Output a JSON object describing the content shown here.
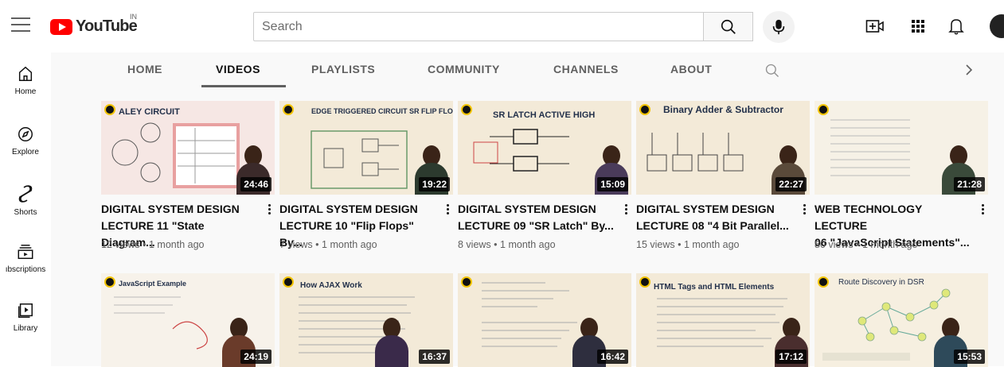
{
  "header": {
    "logo_text": "YouTube",
    "country": "IN",
    "search_placeholder": "Search",
    "icons": [
      "menu-icon",
      "search-icon",
      "mic-icon",
      "create-video-icon",
      "apps-grid-icon",
      "notifications-bell-icon",
      "avatar"
    ]
  },
  "sidebar": {
    "items": [
      {
        "label": "Home",
        "icon": "home-icon"
      },
      {
        "label": "Explore",
        "icon": "compass-icon"
      },
      {
        "label": "Shorts",
        "icon": "shorts-icon"
      },
      {
        "label": "ıbscriptions",
        "icon": "subscriptions-icon"
      },
      {
        "label": "Library",
        "icon": "library-icon"
      }
    ]
  },
  "tabs": {
    "items": [
      "HOME",
      "VIDEOS",
      "PLAYLISTS",
      "COMMUNITY",
      "CHANNELS",
      "ABOUT"
    ],
    "active": "VIDEOS"
  },
  "videos": [
    {
      "title_line1": "DIGITAL SYSTEM DESIGN",
      "title_line2": "LECTURE 11 \"State Diagram...",
      "views": "12 views",
      "age": "1 month ago",
      "duration": "24:46",
      "thumb_text": "ALEY CIRCUIT"
    },
    {
      "title_line1": "DIGITAL SYSTEM DESIGN",
      "title_line2": "LECTURE 10 \"Flip Flops\" By...",
      "views": "7 views",
      "age": "1 month ago",
      "duration": "19:22",
      "thumb_text": "EDGE TRIGGERED CIRCUIT SR FLIP FLOP"
    },
    {
      "title_line1": "DIGITAL SYSTEM DESIGN",
      "title_line2": "LECTURE 09 \"SR Latch\" By...",
      "views": "8 views",
      "age": "1 month ago",
      "duration": "15:09",
      "thumb_text": "SR LATCH ACTIVE HIGH"
    },
    {
      "title_line1": "DIGITAL SYSTEM DESIGN",
      "title_line2": "LECTURE 08 \"4 Bit Parallel...",
      "views": "15 views",
      "age": "1 month ago",
      "duration": "22:27",
      "thumb_text": "Binary Adder & Subtractor"
    },
    {
      "title_line1": "WEB TECHNOLOGY LECTURE",
      "title_line2": "06 \"JavaScript Statements\"...",
      "views": "80 views",
      "age": "1 month ago",
      "duration": "21:28",
      "thumb_text": ""
    },
    {
      "duration": "24:19",
      "thumb_text": "JavaScript Example"
    },
    {
      "duration": "16:37",
      "thumb_text": "How AJAX Work"
    },
    {
      "duration": "16:42",
      "thumb_text": ""
    },
    {
      "duration": "17:12",
      "thumb_text": "HTML Tags and HTML Elements"
    },
    {
      "duration": "15:53",
      "thumb_text": "Route Discovery in DSR"
    }
  ],
  "meta_separator": "•",
  "colors": {
    "brand_red": "#ff0000",
    "text_primary": "#0f0f0f",
    "text_secondary": "#606060",
    "page_bg": "#f9f9f9"
  }
}
